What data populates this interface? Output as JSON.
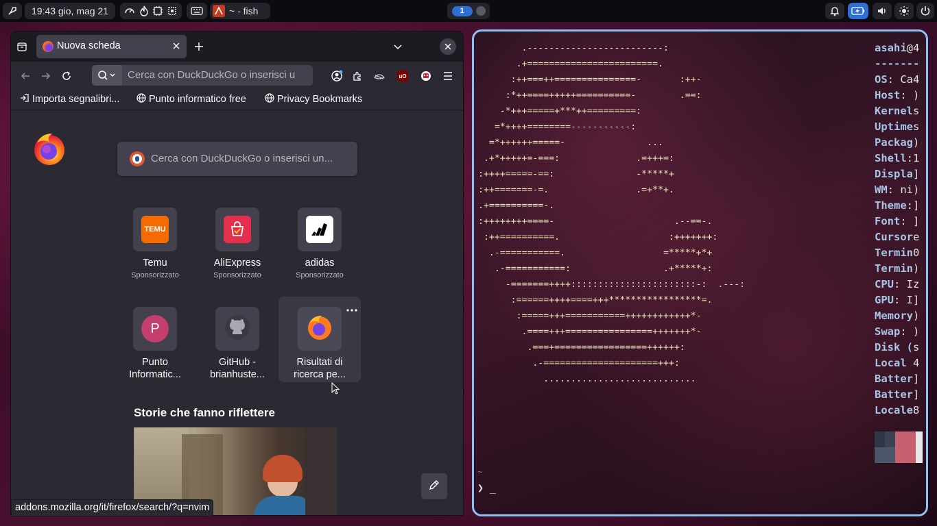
{
  "topbar": {
    "clock": "19:43 gio, mag 21",
    "window_title": "~ - fish",
    "workspace": "1"
  },
  "firefox": {
    "tab_title": "Nuova scheda",
    "url_placeholder": "Cerca con DuckDuckGo o inserisci u",
    "bookmarks": [
      "Importa segnalibri...",
      "Punto informatico free",
      "Privacy Bookmarks"
    ],
    "newtab_search_placeholder": "Cerca con DuckDuckGo o inserisci un...",
    "top_sites": [
      {
        "title": "Temu",
        "sponsored": "Sponsorizzato",
        "logo_text": "TEMU"
      },
      {
        "title": "AliExpress",
        "sponsored": "Sponsorizzato"
      },
      {
        "title": "adidas",
        "sponsored": "Sponsorizzato"
      },
      {
        "title": "Punto Informatic...",
        "letter": "P"
      },
      {
        "title": "GitHub - brianhuste..."
      },
      {
        "title": "Risultati di ricerca pe..."
      }
    ],
    "stories_heading": "Storie che fanno riflettere",
    "status_url": "addons.mozilla.org/it/firefox/search/?q=nvim"
  },
  "terminal": {
    "ascii_art": "        .-------------------------:\n       .+========================.\n      :++===++===============-       :++-\n     :*++====+++++==========-        .==:\n    -*+++=====+***++=========:\n   =*++++========-----------:\n  =*++++++=====-               ...\n .+*+++++=-===:              .=+++=:\n:++++=====-==:               -*****+\n:++=======-=.                .=+**+.\n.+==========-.\n:++++++++====-                      .--==-.\n :++==========.                    :+++++++:\n  .-===========.                  =*****+*+\n   .-===========:                 .+*****+:\n     -=======++++:::::::::::::::::::::::-:  .---:\n      :======++++====+++*****************=.\n       :=====+++===========++++++++++++*-\n        .====+++================+++++++*-\n         .===+=================++++++:\n          .-=====================+++:\n            ............................",
    "fetch_keys": [
      {
        "k": "asahi",
        "v": "@4"
      },
      {
        "k": "-------",
        "v": ""
      },
      {
        "k": "OS",
        "v": ": Ca4"
      },
      {
        "k": "Host",
        "v": ": )"
      },
      {
        "k": "Kernel",
        "v": "s"
      },
      {
        "k": "Uptime",
        "v": "s"
      },
      {
        "k": "Packag",
        "v": ")"
      },
      {
        "k": "Shell",
        "v": ":1"
      },
      {
        "k": "Displa",
        "v": "]"
      },
      {
        "k": "WM",
        "v": ": ni)"
      },
      {
        "k": "Theme",
        "v": ":]"
      },
      {
        "k": "Font",
        "v": ": ]"
      },
      {
        "k": "Cursor",
        "v": "e"
      },
      {
        "k": "Termin",
        "v": "0"
      },
      {
        "k": "Termin",
        "v": ")"
      },
      {
        "k": "CPU",
        "v": ": Iz"
      },
      {
        "k": "GPU",
        "v": ": I]"
      },
      {
        "k": "Memory",
        "v": ")"
      },
      {
        "k": "Swap",
        "v": ": )"
      },
      {
        "k": "Disk (",
        "v": "s"
      },
      {
        "k": "Local",
        "v": " 4"
      },
      {
        "k": "Batter",
        "v": "]"
      },
      {
        "k": "Batter",
        "v": "]"
      },
      {
        "k": "Locale",
        "v": "8"
      }
    ],
    "prompt_tilde": "~",
    "prompt": "❯ _"
  },
  "colors": {
    "terminal_border": "#8cc1f2",
    "ascii": "#eae4b4",
    "fetch_key": "#a8c4e6",
    "firefox_bg": "#2b2a33"
  }
}
